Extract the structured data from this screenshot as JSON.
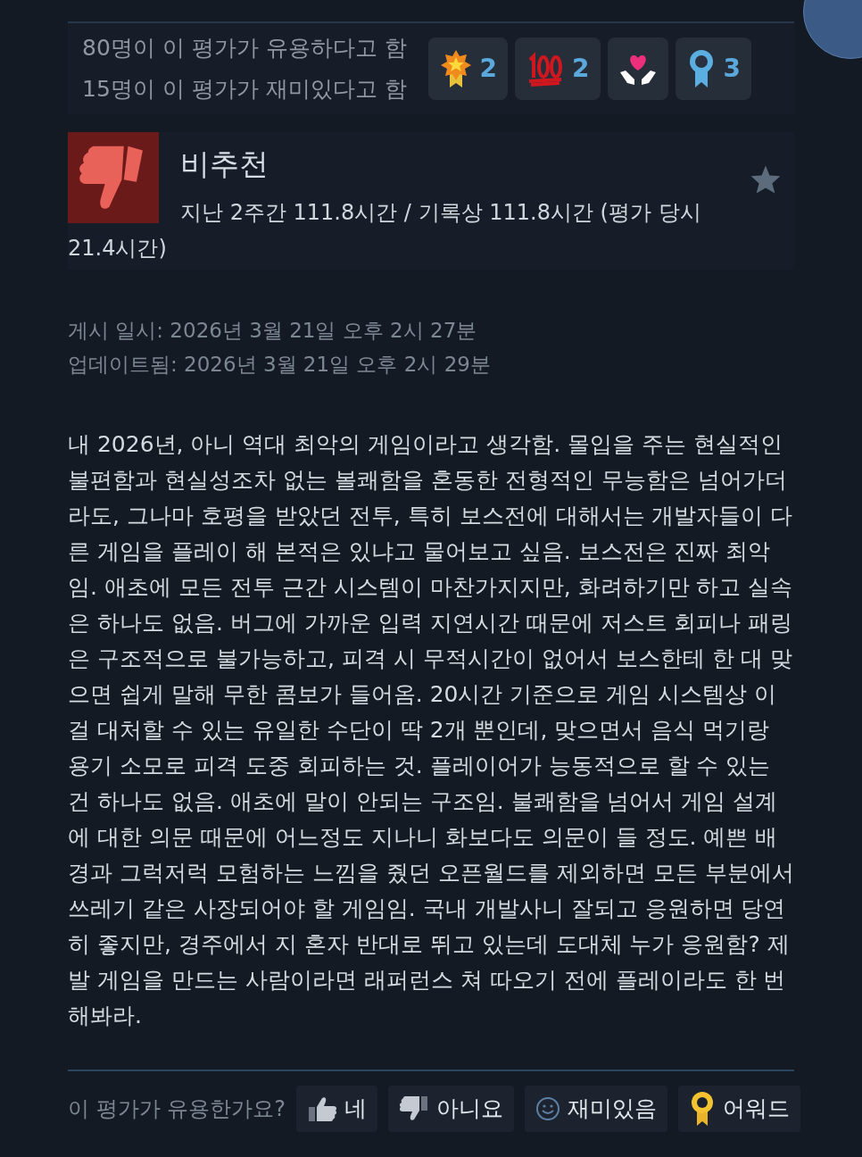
{
  "summary": {
    "lines": [
      "80명이 이 평가가 유용하다고 함",
      "15명이 이 평가가 재미있다고 함"
    ],
    "awards": [
      {
        "kind": "medal",
        "count": "2"
      },
      {
        "kind": "hundred",
        "count": "2"
      },
      {
        "kind": "heart"
      },
      {
        "kind": "ribbon",
        "count": "3"
      }
    ]
  },
  "review": {
    "verdict": "비추천",
    "recommended": false,
    "hours": "지난 2주간 111.8시간 / 기록상 111.8시간 (평가 당시 21.4시간)",
    "posted": "게시 일시: 2026년 3월 21일 오후 2시 27분",
    "updated": "업데이트됨: 2026년 3월 21일 오후 2시 29분",
    "body": "내 2026년, 아니 역대 최악의 게임이라고 생각함. 몰입을 주는 현실적인 불편함과 현실성조차 없는 볼쾌함을 혼동한 전형적인 무능함은 넘어가더라도, 그나마 호평을 받았던 전투, 특히 보스전에 대해서는 개발자들이 다른 게임을 플레이 해 본적은 있냐고 물어보고 싶음. 보스전은 진짜 최악임. 애초에 모든 전투 근간 시스템이 마찬가지지만, 화려하기만 하고 실속은 하나도 없음. 버그에 가까운 입력 지연시간 때문에 저스트 회피나 패링은 구조적으로 불가능하고, 피격 시 무적시간이 없어서 보스한테 한 대 맞으면 쉽게 말해 무한 콤보가 들어옴. 20시간 기준으로 게임 시스템상 이걸 대처할 수 있는 유일한 수단이 딱 2개 뿐인데, 맞으면서 음식 먹기랑 용기 소모로 피격 도중 회피하는 것. 플레이어가 능동적으로 할 수 있는 건 하나도 없음. 애초에 말이 안되는 구조임. 불쾌함을 넘어서 게임 설계에 대한 의문 때문에 어느정도 지나니 화보다도 의문이 들 정도. 예쁜 배경과 그럭저럭 모험하는 느낌을 줬던 오픈월드를 제외하면 모든 부분에서 쓰레기 같은 사장되어야 할 게임임. 국내 개발사니 잘되고 응원하면 당연히 좋지만, 경주에서 지 혼자 반대로 뛰고 있는데 도대체 누가 응원함? 제발 게임을 만드는 사람이라면 래퍼런스 쳐 따오기 전에 플레이라도 한 번 해봐라."
  },
  "vote": {
    "question": "이 평가가 유용한가요?",
    "buttons": [
      {
        "kind": "up",
        "label": "네"
      },
      {
        "kind": "down",
        "label": "아니요"
      },
      {
        "kind": "funny",
        "label": "재미있음"
      },
      {
        "kind": "award",
        "label": "어워드"
      }
    ]
  }
}
